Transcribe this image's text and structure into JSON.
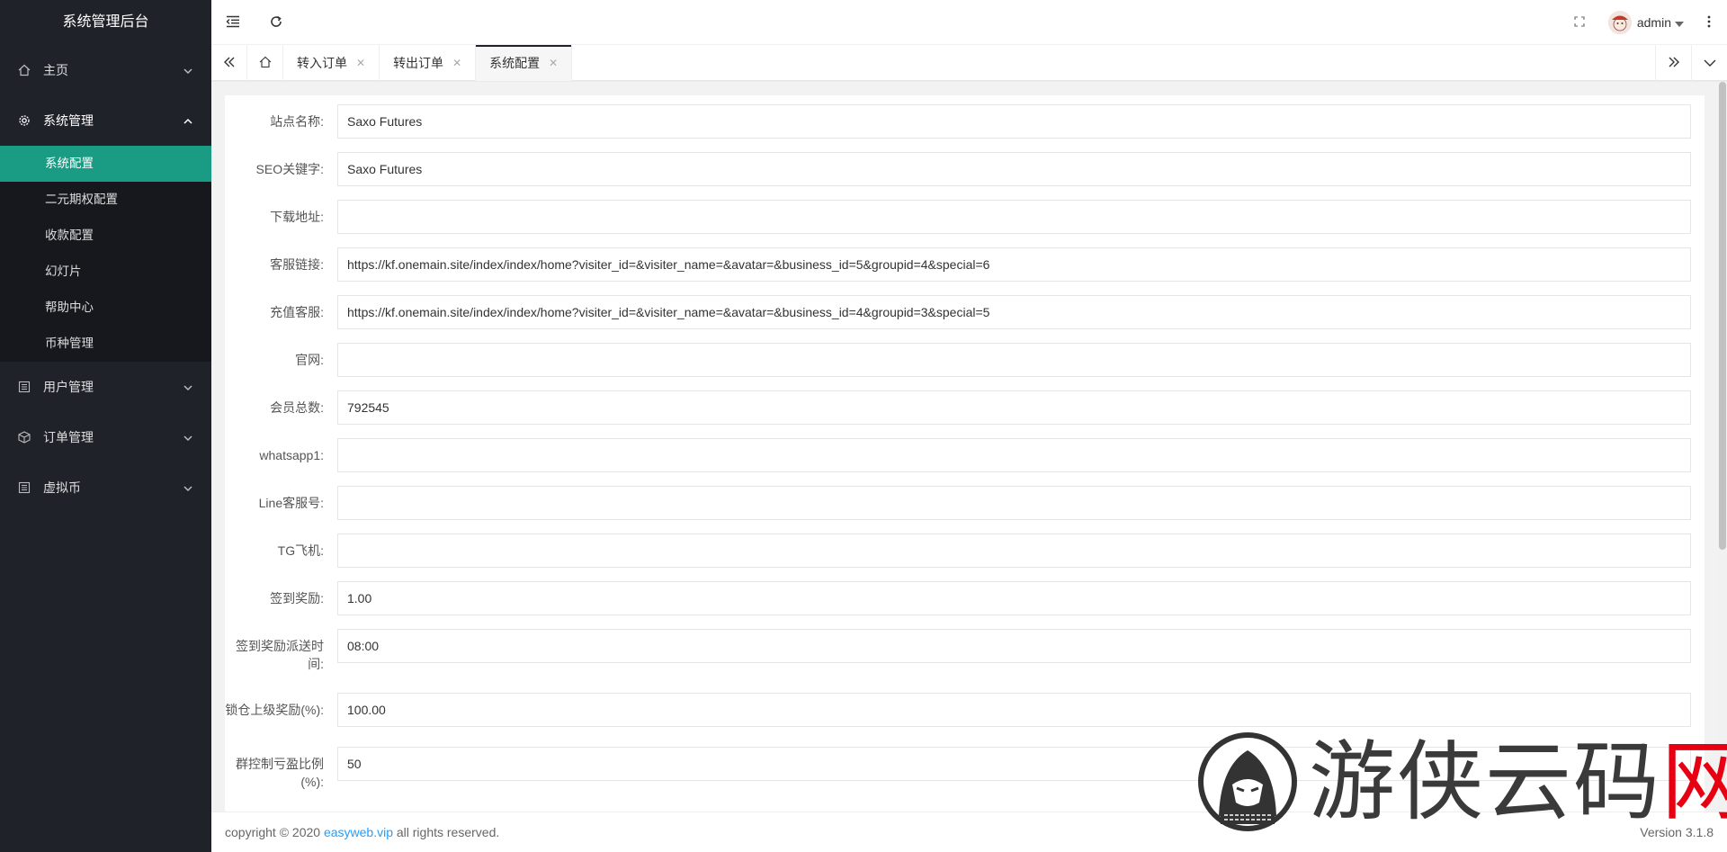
{
  "sidebar": {
    "title": "系统管理后台",
    "menu": [
      {
        "label": "主页"
      },
      {
        "label": "系统管理"
      },
      {
        "label": "用户管理"
      },
      {
        "label": "订单管理"
      },
      {
        "label": "虚拟币"
      }
    ],
    "sub": [
      {
        "label": "系统配置"
      },
      {
        "label": "二元期权配置"
      },
      {
        "label": "收款配置"
      },
      {
        "label": "幻灯片"
      },
      {
        "label": "帮助中心"
      },
      {
        "label": "币种管理"
      }
    ]
  },
  "header": {
    "username": "admin"
  },
  "tabs": [
    {
      "label": "转入订单"
    },
    {
      "label": "转出订单"
    },
    {
      "label": "系统配置"
    }
  ],
  "form": [
    {
      "label": "站点名称:",
      "value": "Saxo Futures"
    },
    {
      "label": "SEO关键字:",
      "value": "Saxo Futures"
    },
    {
      "label": "下载地址:",
      "value": ""
    },
    {
      "label": "客服链接:",
      "value": "https://kf.onemain.site/index/index/home?visiter_id=&visiter_name=&avatar=&business_id=5&groupid=4&special=6"
    },
    {
      "label": "充值客服:",
      "value": "https://kf.onemain.site/index/index/home?visiter_id=&visiter_name=&avatar=&business_id=4&groupid=3&special=5"
    },
    {
      "label": "官网:",
      "value": ""
    },
    {
      "label": "会员总数:",
      "value": "792545"
    },
    {
      "label": "whatsapp1:",
      "value": ""
    },
    {
      "label": "Line客服号:",
      "value": ""
    },
    {
      "label": "TG飞机:",
      "value": ""
    },
    {
      "label": "签到奖励:",
      "value": "1.00"
    },
    {
      "label": "签到奖励派送时间:",
      "value": "08:00"
    },
    {
      "label": "锁仓上级奖励(%):",
      "value": "100.00"
    },
    {
      "label": "群控制亏盈比例(%):",
      "value": "50"
    }
  ],
  "footer": {
    "copyright_prefix": "copyright © 2020 ",
    "link": "easyweb.vip",
    "copyright_suffix": " all rights reserved.",
    "version": "Version 3.1.8"
  },
  "watermark": {
    "text_main": "游侠云码",
    "text_red": "网"
  }
}
